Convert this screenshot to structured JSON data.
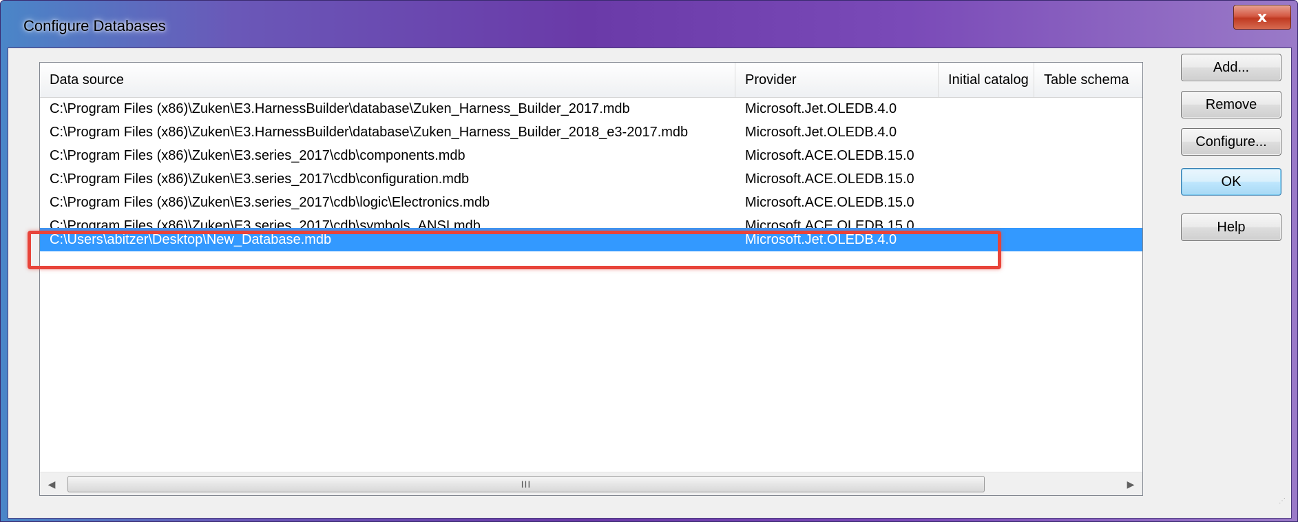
{
  "window": {
    "title": "Configure Databases",
    "close_label": "x"
  },
  "list": {
    "columns": [
      "Data source",
      "Provider",
      "Initial catalog",
      "Table schema"
    ],
    "rows": [
      {
        "data_source": "C:\\Program Files (x86)\\Zuken\\E3.HarnessBuilder\\database\\Zuken_Harness_Builder_2017.mdb",
        "provider": "Microsoft.Jet.OLEDB.4.0"
      },
      {
        "data_source": "C:\\Program Files (x86)\\Zuken\\E3.HarnessBuilder\\database\\Zuken_Harness_Builder_2018_e3-2017.mdb",
        "provider": "Microsoft.Jet.OLEDB.4.0"
      },
      {
        "data_source": "C:\\Program Files (x86)\\Zuken\\E3.series_2017\\cdb\\components.mdb",
        "provider": "Microsoft.ACE.OLEDB.15.0"
      },
      {
        "data_source": "C:\\Program Files (x86)\\Zuken\\E3.series_2017\\cdb\\configuration.mdb",
        "provider": "Microsoft.ACE.OLEDB.15.0"
      },
      {
        "data_source": "C:\\Program Files (x86)\\Zuken\\E3.series_2017\\cdb\\logic\\Electronics.mdb",
        "provider": "Microsoft.ACE.OLEDB.15.0"
      },
      {
        "data_source": "C:\\Program Files (x86)\\Zuken\\E3.series_2017\\cdb\\symbols_ANSI.mdb",
        "provider": "Microsoft.ACE.OLEDB.15.0"
      },
      {
        "data_source": "C:\\Users\\abitzer\\Desktop\\New_Database.mdb",
        "provider": "Microsoft.Jet.OLEDB.4.0"
      }
    ],
    "scrollbar_grip": "III"
  },
  "buttons": {
    "add": "Add...",
    "remove": "Remove",
    "configure": "Configure...",
    "ok": "OK",
    "help": "Help"
  },
  "colors": {
    "selection": "#3399ff",
    "highlight_border": "#e8443a"
  }
}
